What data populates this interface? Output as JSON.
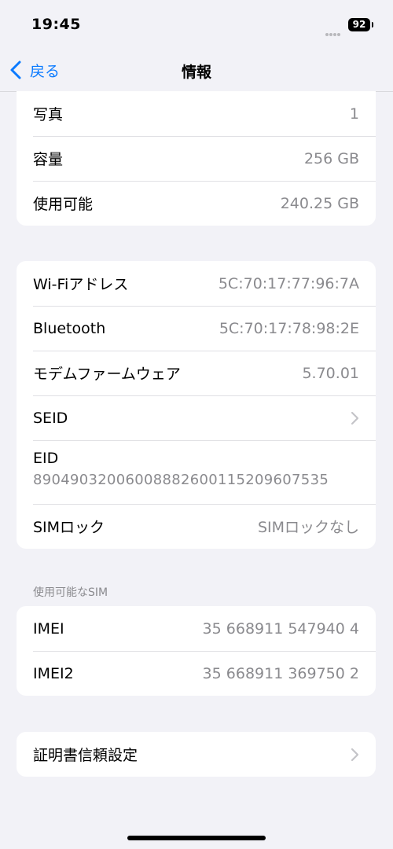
{
  "status": {
    "time": "19:45",
    "battery": "92"
  },
  "nav": {
    "back_label": "戻る",
    "title": "情報"
  },
  "storage": {
    "photos_label": "写真",
    "photos_value": "1",
    "capacity_label": "容量",
    "capacity_value": "256 GB",
    "available_label": "使用可能",
    "available_value": "240.25 GB"
  },
  "network": {
    "wifi_label": "Wi-Fiアドレス",
    "wifi_value": "5C:70:17:77:96:7A",
    "bluetooth_label": "Bluetooth",
    "bluetooth_value": "5C:70:17:78:98:2E",
    "modem_label": "モデムファームウェア",
    "modem_value": "5.70.01",
    "seid_label": "SEID",
    "eid_label": "EID",
    "eid_value": "89049032006008882600115209607535",
    "simlock_label": "SIMロック",
    "simlock_value": "SIMロックなし"
  },
  "sim_section": {
    "header": "使用可能なSIM",
    "imei_label": "IMEI",
    "imei_value": "35 668911 547940 4",
    "imei2_label": "IMEI2",
    "imei2_value": "35 668911 369750 2"
  },
  "certificates": {
    "label": "証明書信頼設定"
  }
}
